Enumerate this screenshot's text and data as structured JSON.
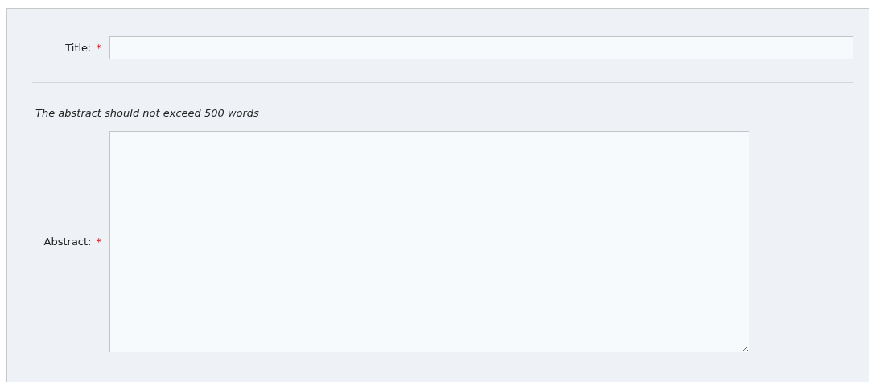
{
  "fields": [
    {
      "kind": "text",
      "label": "Title:",
      "required_mark": "*"
    },
    {
      "kind": "divider"
    },
    {
      "kind": "hint",
      "text": "The abstract should not exceed 500 words"
    },
    {
      "kind": "textarea",
      "label": "Abstract:",
      "required_mark": "*"
    }
  ]
}
